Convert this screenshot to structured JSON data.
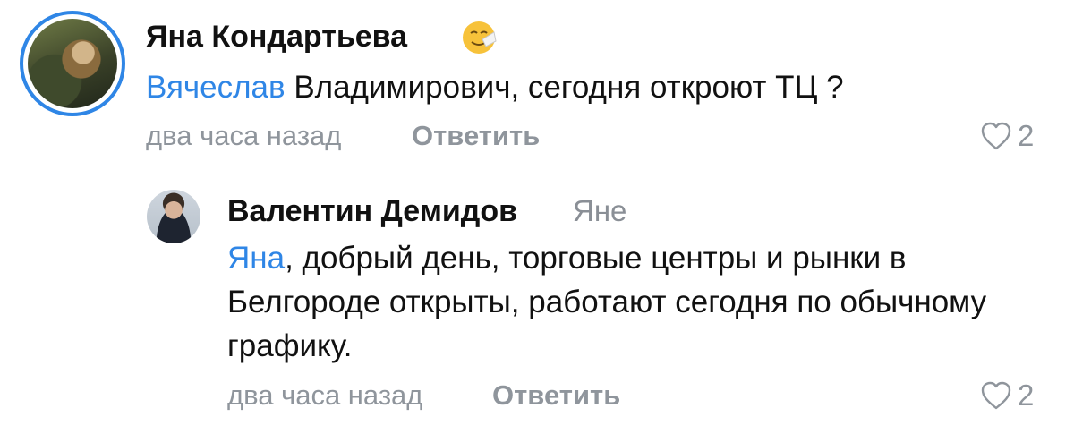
{
  "comment": {
    "author": "Яна Кондартьева",
    "emoji_icon": "sneezing-face-emoji",
    "mention": "Вячеслав",
    "text": " Владимирович, сегодня откроют ТЦ ?",
    "time": "два часа назад",
    "reply_label": "Ответить",
    "likes": "2"
  },
  "reply": {
    "author": "Валентин Демидов",
    "addressee": "Яне",
    "mention": "Яна",
    "text": ", добрый день, торговые центры и рынки в Белгороде открыты, работают сегодня по обычному графику.",
    "time": "два часа назад",
    "reply_label": "Ответить",
    "likes": "2"
  },
  "colors": {
    "accent": "#2f86e6",
    "muted": "#8f959c",
    "text": "#111111"
  }
}
